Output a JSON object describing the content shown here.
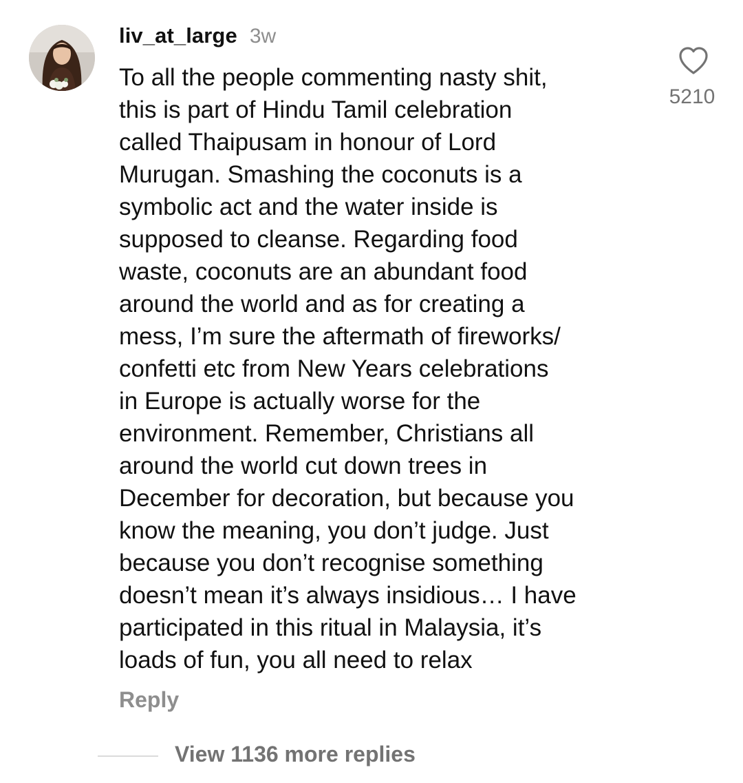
{
  "comment": {
    "username": "liv_at_large",
    "time_ago": "3w",
    "lines": [
      "To all the people commenting nasty shit,",
      "this is part of Hindu Tamil celebration",
      "called Thaipusam in honour of Lord",
      "Murugan. Smashing the coconuts is a",
      "symbolic act and the water inside is",
      "supposed to cleanse. Regarding food",
      "waste, coconuts are an abundant food",
      "around the world and as for creating a",
      "mess, I’m sure the aftermath of fireworks/",
      "confetti etc from New Years celebrations",
      "in Europe is actually worse for the",
      "environment. Remember, Christians all",
      "around the world cut down trees in",
      "December for decoration, but because you",
      "know the meaning, you don’t judge. Just",
      "because you don’t recognise something",
      "doesn’t mean it’s always insidious… I have",
      "participated in this ritual in Malaysia, it’s",
      "loads of fun, you all need to relax"
    ],
    "like_count": "5210",
    "reply_label": "Reply",
    "view_replies_label": "View 1136 more replies",
    "like_icon": "heart-outline-icon"
  },
  "colors": {
    "text_primary": "#111111",
    "text_secondary": "#8e8e8e",
    "divider": "#dbdbdb"
  }
}
